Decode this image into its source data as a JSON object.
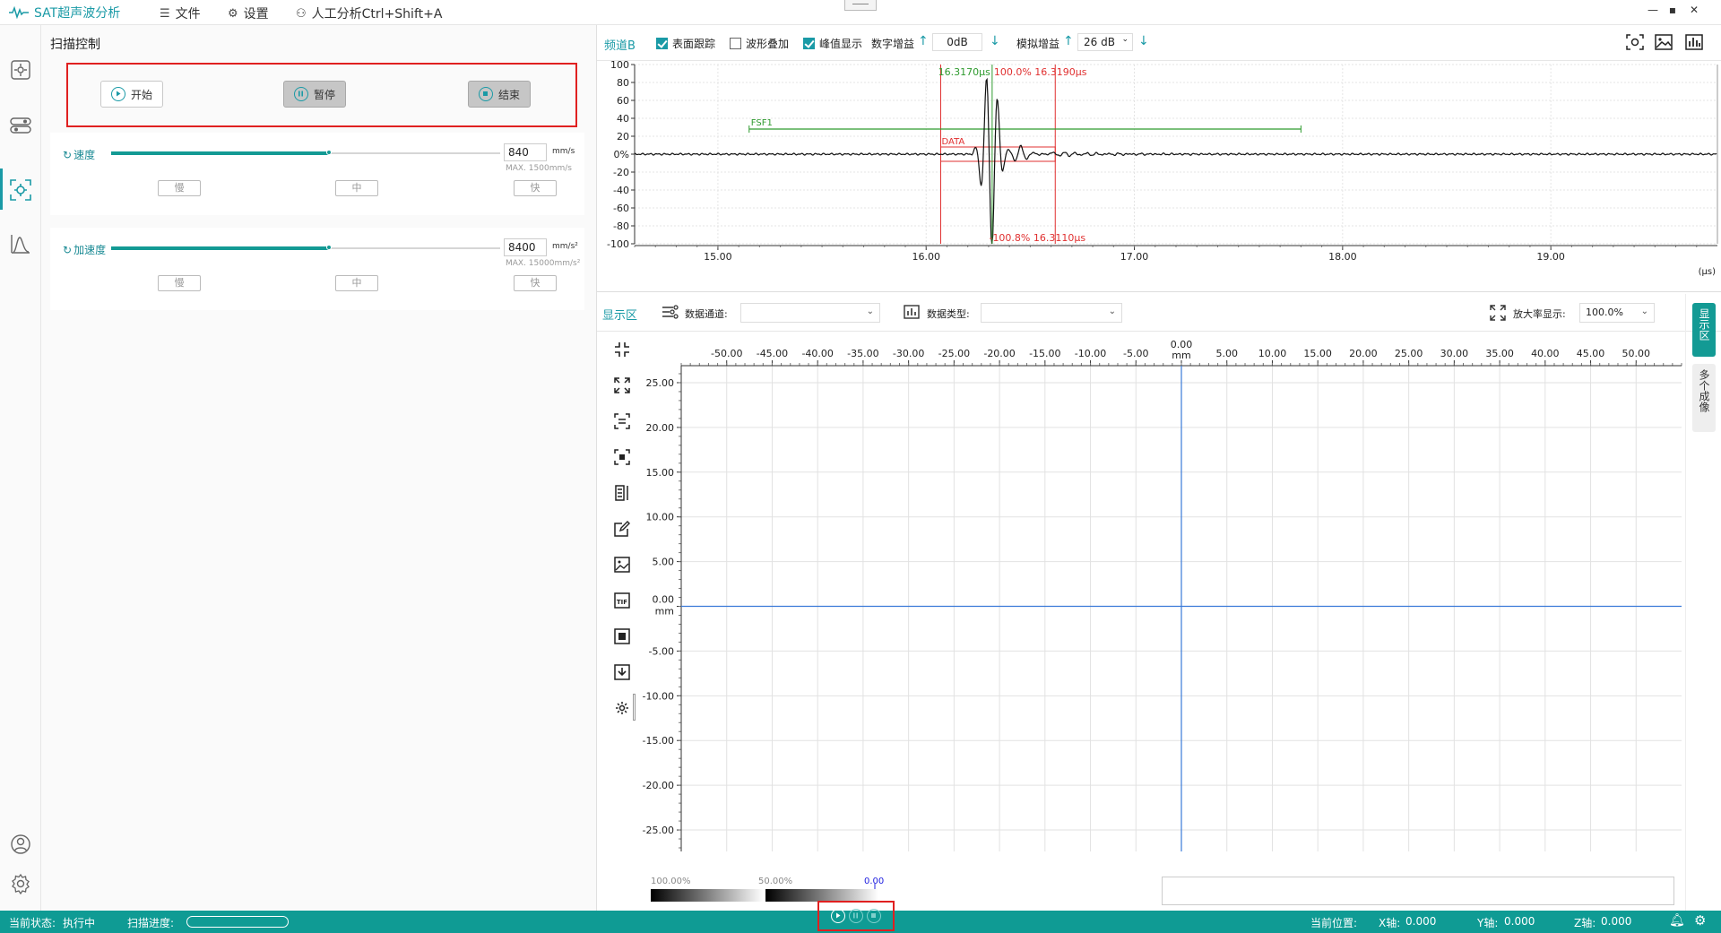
{
  "app": {
    "title": "SAT超声波分析",
    "menu": [
      {
        "icon": "list-icon",
        "label": "文件"
      },
      {
        "icon": "gear-icon",
        "label": "设置"
      },
      {
        "icon": "user-analysis-icon",
        "label": "人工分析Ctrl+Shift+A"
      }
    ],
    "window_controls": [
      "—",
      "▪",
      "✕"
    ]
  },
  "leftnav": {
    "items": [
      "scan-settings-icon",
      "toggle-icon",
      "scan-target-icon",
      "waveform-analysis-icon"
    ],
    "active_index": 2,
    "bottom": [
      "account-icon",
      "settings-icon"
    ]
  },
  "scan_control": {
    "title": "扫描控制",
    "buttons": {
      "start": "开始",
      "pause": "暂停",
      "stop": "结束"
    },
    "speed": {
      "label": "速度",
      "value": "840",
      "unit": "mm/s",
      "max": "MAX. 1500mm/s",
      "fraction": 0.56,
      "presets": [
        "慢",
        "中",
        "快"
      ]
    },
    "accel": {
      "label": "加速度",
      "value": "8400",
      "unit": "mm/s²",
      "max": "MAX. 15000mm/s²",
      "fraction": 0.56,
      "presets": [
        "慢",
        "中",
        "快"
      ]
    }
  },
  "channel": {
    "name": "频道B",
    "checks": [
      {
        "label": "表面跟踪",
        "checked": true
      },
      {
        "label": "波形叠加",
        "checked": false
      },
      {
        "label": "峰值显示",
        "checked": true
      }
    ],
    "digital_gain_label": "数字增益",
    "digital_gain_value": "0dB",
    "analog_gain_label": "模拟增益",
    "analog_gain_value": "26 dB",
    "toolbar_icons": [
      "screenshot-icon",
      "image-icon",
      "histogram-icon"
    ]
  },
  "chart_data": [
    {
      "type": "line",
      "title": "",
      "xlabel": "(μs)",
      "ylabel": "",
      "xlim": [
        14.6,
        19.8
      ],
      "ylim": [
        -100,
        100
      ],
      "x_ticks": [
        "15.00",
        "16.00",
        "17.00",
        "18.00",
        "19.00"
      ],
      "y_ticks": [
        "100",
        "80",
        "60",
        "40",
        "20",
        "0%",
        "-20",
        "-40",
        "-60",
        "-80",
        "-100"
      ],
      "grid": true,
      "annotations": {
        "gate_fsf1": {
          "label": "FSF1",
          "x_start": 15.15,
          "x_end": 17.8,
          "y": 28
        },
        "gate_data": {
          "label": "DATA",
          "x_start": 16.07,
          "x_end": 16.62,
          "y_top": 8,
          "y_bottom": -8
        },
        "peak_top_green": "16.3170μs",
        "peak_top_red": "100.0% 16.3190μs",
        "peak_bottom_red": "-100.8% 16.3110μs"
      }
    },
    {
      "type": "scatter",
      "title": "",
      "xlabel": "mm",
      "ylabel": "mm",
      "xlim": [
        -55,
        55
      ],
      "ylim": [
        -28,
        28
      ],
      "x_ticks": [
        "-50.00",
        "-45.00",
        "-40.00",
        "-35.00",
        "-30.00",
        "-25.00",
        "-20.00",
        "-15.00",
        "-10.00",
        "-5.00",
        "0.00",
        "5.00",
        "10.00",
        "15.00",
        "20.00",
        "25.00",
        "30.00",
        "35.00",
        "40.00",
        "45.00",
        "50.00"
      ],
      "y_ticks": [
        "25.00",
        "20.00",
        "15.00",
        "10.00",
        "5.00",
        "0.00",
        "-5.00",
        "-10.00",
        "-15.00",
        "-20.00",
        "-25.00"
      ],
      "grid": true
    }
  ],
  "display": {
    "title": "显示区",
    "data_channel_label": "数据通道:",
    "data_channel_value": "",
    "data_type_label": "数据类型:",
    "data_type_value": "",
    "zoom_label": "放大率显示:",
    "zoom_value": "100.0%",
    "side_tools": [
      "collapse-icon",
      "expand-icon",
      "fit-view-icon",
      "focus-icon",
      "column-icon",
      "edit-icon",
      "image-icon",
      "tif-icon",
      "stop-frame-icon",
      "download-icon",
      "settings-icon"
    ],
    "right_tabs": [
      {
        "label": "显示区",
        "active": true
      },
      {
        "label": "多个成像",
        "active": false
      }
    ],
    "colorbar_labels": [
      "100.00%",
      "50.00%",
      "0.00%"
    ]
  },
  "status": {
    "state_label": "当前状态:",
    "state_value": "执行中",
    "progress_label": "扫描进度:",
    "progress": 0.0,
    "position_label": "当前位置:",
    "x_label": "X轴:",
    "x_value": "0.000",
    "y_label": "Y轴:",
    "y_value": "0.000",
    "z_label": "Z轴:",
    "z_value": "0.000"
  },
  "colors": {
    "accent": "#1a9aa6",
    "status_bar": "#0f9b94",
    "highlight": "#e02020",
    "gate_green": "#2e9a2e",
    "gate_red": "#e03030",
    "grid": "#e2e2e2",
    "cursor_blue": "#3a7ad8"
  }
}
